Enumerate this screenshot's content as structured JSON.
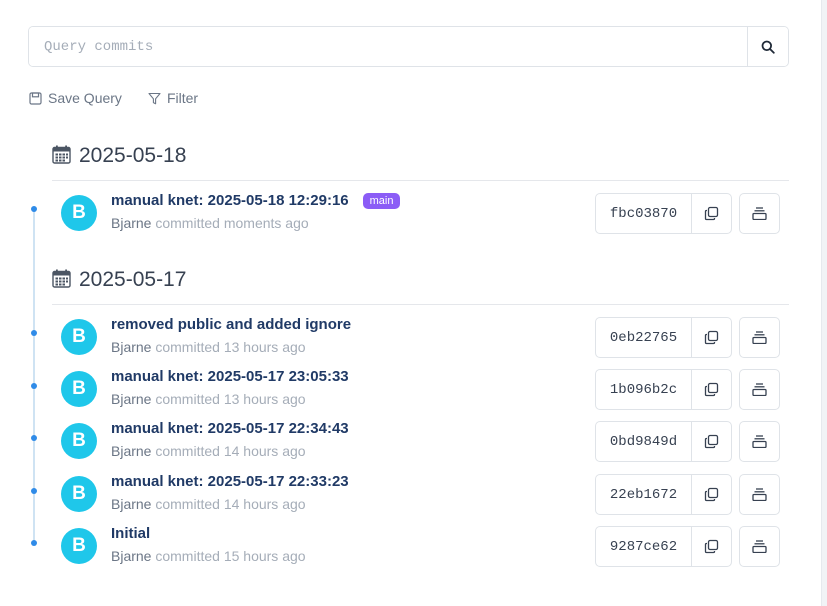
{
  "search": {
    "placeholder": "Query commits"
  },
  "toolbar": {
    "save_label": "Save Query",
    "filter_label": "Filter"
  },
  "groups": [
    {
      "date": "2025-05-18",
      "commits": [
        {
          "message": "manual knet: 2025-05-18 12:29:16",
          "badge": "main",
          "author": "Bjarne",
          "action": "committed",
          "time": "moments ago",
          "sha": "fbc03870",
          "avatar": "B"
        }
      ]
    },
    {
      "date": "2025-05-17",
      "commits": [
        {
          "message": "removed public and added ignore",
          "author": "Bjarne",
          "action": "committed",
          "time": "13 hours ago",
          "sha": "0eb22765",
          "avatar": "B"
        },
        {
          "message": "manual knet: 2025-05-17 23:05:33",
          "author": "Bjarne",
          "action": "committed",
          "time": "13 hours ago",
          "sha": "1b096b2c",
          "avatar": "B"
        },
        {
          "message": "manual knet: 2025-05-17 22:34:43",
          "author": "Bjarne",
          "action": "committed",
          "time": "14 hours ago",
          "sha": "0bd9849d",
          "avatar": "B"
        },
        {
          "message": "manual knet: 2025-05-17 22:33:23",
          "author": "Bjarne",
          "action": "committed",
          "time": "14 hours ago",
          "sha": "22eb1672",
          "avatar": "B"
        },
        {
          "message": "Initial",
          "author": "Bjarne",
          "action": "committed",
          "time": "15 hours ago",
          "sha": "9287ce62",
          "avatar": "B"
        }
      ]
    }
  ],
  "colors": {
    "accent": "#2f8be8",
    "avatar": "#1fc7ea",
    "badge": "#8b5cf6",
    "commit_title": "#203a66"
  }
}
